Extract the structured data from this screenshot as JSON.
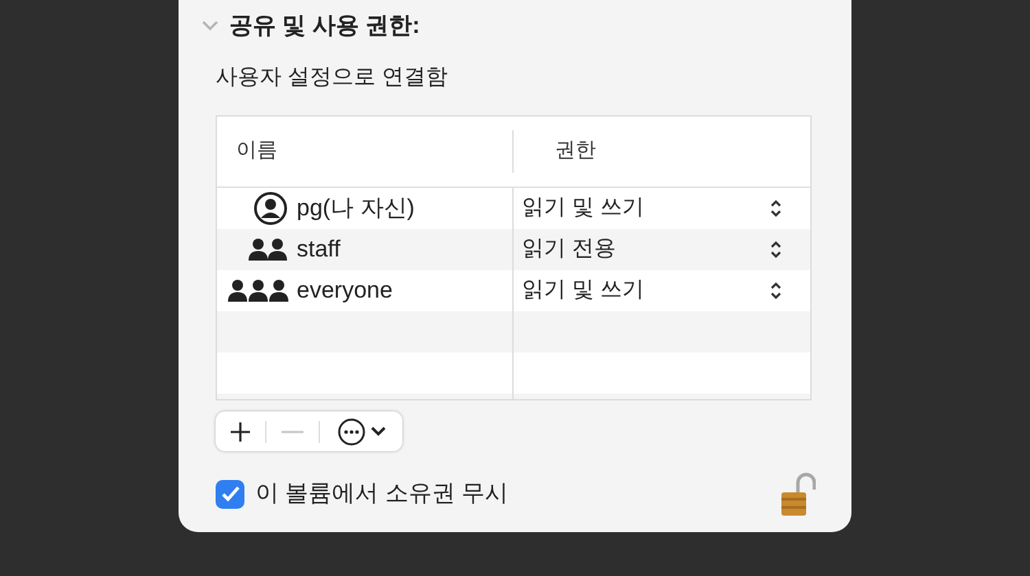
{
  "section": {
    "title": "공유 및 사용 권한:",
    "expanded": true
  },
  "subtitle": "사용자 설정으로 연결함",
  "table": {
    "columns": [
      "이름",
      "권한"
    ],
    "rows": [
      {
        "kind": "user",
        "name": "pg(나 자신)",
        "permission": "읽기 및 쓰기"
      },
      {
        "kind": "group",
        "name": "staff",
        "permission": "읽기 전용"
      },
      {
        "kind": "everyone",
        "name": "everyone",
        "permission": "읽기 및 쓰기"
      }
    ]
  },
  "toolbar": {
    "remove_disabled": true
  },
  "ignore_ownership": {
    "label": "이 볼륨에서 소유권 무시",
    "checked": true
  },
  "lock": {
    "locked": false
  }
}
